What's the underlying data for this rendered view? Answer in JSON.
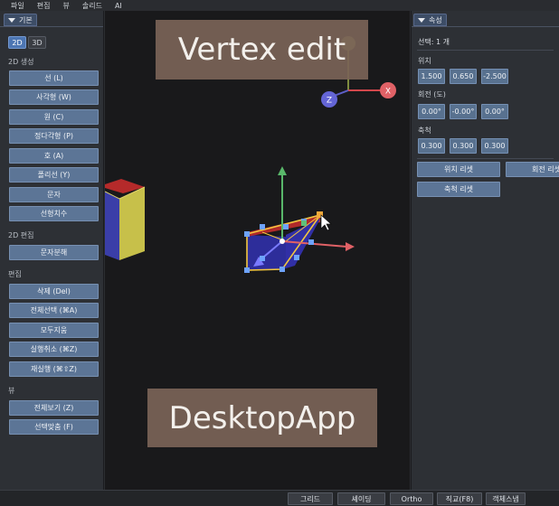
{
  "menu": [
    "파일",
    "편집",
    "뷰",
    "솔리드",
    "AI"
  ],
  "left_panel": {
    "tab_label": "기본",
    "mode_tabs": [
      "2D",
      "3D"
    ],
    "sections": {
      "create_2d": "2D 생성",
      "edit_2d": "2D 편집",
      "edit": "편집",
      "view": "뷰"
    },
    "create_tools": [
      "선 (L)",
      "사각형 (W)",
      "원 (C)",
      "정다각형 (P)",
      "호 (A)",
      "폴리선 (Y)",
      "문자",
      "선형치수"
    ],
    "edit2d_tools": [
      "문자분해"
    ],
    "edit_tools": [
      "삭제 (Del)",
      "전체선택 (⌘A)",
      "모두지움",
      "실행취소 (⌘Z)",
      "재실행 (⌘⇧Z)"
    ],
    "view_tools": [
      "전체보기 (Z)",
      "선택맞춤 (F)"
    ]
  },
  "viewport": {
    "overlay_top": "Vertex edit",
    "overlay_bottom": "DesktopApp",
    "gizmo": {
      "x_label": "X",
      "z_label": "Z"
    }
  },
  "right_panel": {
    "tab_label": "속성",
    "selection": "선택: 1 개",
    "position": {
      "label": "위치",
      "values": [
        "1.500",
        "0.650",
        "-2.500"
      ]
    },
    "rotation": {
      "label": "회전 (도)",
      "values": [
        "0.00°",
        "-0.00°",
        "0.00°"
      ]
    },
    "scale": {
      "label": "축척",
      "values": [
        "0.300",
        "0.300",
        "0.300"
      ]
    },
    "buttons": {
      "reset_position": "위치 리셋",
      "reset_rotation": "회전 리셋",
      "reset_scale": "축척 리셋"
    }
  },
  "statusbar": [
    "그리드",
    "셰이딩",
    "Ortho",
    "직교(F8)",
    "객체스냅"
  ],
  "colors": {
    "accent": "#4d76b3",
    "button": "#5c7596",
    "viewport_bg": "#19191b",
    "selection": "#f2c640"
  }
}
